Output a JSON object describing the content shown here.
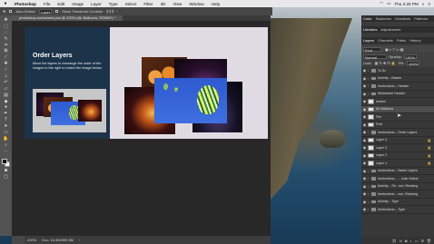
{
  "menubar": {
    "app_name": "Photoshop",
    "items": [
      "File",
      "Edit",
      "Image",
      "Layer",
      "Type",
      "Select",
      "Filter",
      "3D",
      "View",
      "Window",
      "Help"
    ],
    "clock": "Thu 2:20 PM"
  },
  "options_bar": {
    "auto_select_label": "Auto-Select:",
    "auto_select_value": "Layer",
    "transform_label": "Show Transform Controls"
  },
  "document": {
    "tab_title": "photoshop-worksheet.psd @ 200% (Air Balloons, RGB/8*) *",
    "zoom": "200%",
    "doc_size": "Doc: 24.9M/359.5M"
  },
  "canvas": {
    "title": "Order Layers",
    "instructions": "Move the layers to rearrange the order of the images to the right to match the image below."
  },
  "panels": {
    "top_tabs": [
      "Color",
      "Swatches",
      "Gradients",
      "Patterns"
    ],
    "mid_tabs": [
      "Libraries",
      "Adjustments"
    ],
    "layer_tabs": [
      "Layers",
      "Channels",
      "Paths",
      "History"
    ],
    "kind_label": "Kind",
    "blend_mode": "Normal",
    "opacity_label": "Opacity:",
    "opacity_value": "100%",
    "lock_label": "Lock:",
    "fill_label": "Fill:",
    "fill_value": "100%"
  },
  "layers": [
    {
      "name": "To Do",
      "type": "group",
      "visible": true,
      "selected": false,
      "locked": false
    },
    {
      "name": "Activity – Basics",
      "type": "group",
      "visible": true,
      "selected": false,
      "locked": false
    },
    {
      "name": "Instructions – Header",
      "type": "group",
      "visible": true,
      "selected": false,
      "locked": false
    },
    {
      "name": "Worksheet Header",
      "type": "group",
      "visible": true,
      "selected": false,
      "locked": false
    },
    {
      "name": "Instant",
      "type": "layer",
      "visible": true,
      "selected": false,
      "locked": false
    },
    {
      "name": "Air Balloons",
      "type": "layer",
      "visible": true,
      "selected": true,
      "locked": false
    },
    {
      "name": "Fire",
      "type": "layer",
      "visible": true,
      "selected": false,
      "locked": false
    },
    {
      "name": "Fruit",
      "type": "layer",
      "visible": true,
      "selected": false,
      "locked": false
    },
    {
      "name": "Instructions – Order Layers",
      "type": "group",
      "visible": true,
      "selected": false,
      "locked": false
    },
    {
      "name": "Layer 4",
      "type": "layer",
      "visible": true,
      "selected": false,
      "locked": true
    },
    {
      "name": "Layer 3",
      "type": "layer",
      "visible": true,
      "selected": false,
      "locked": true
    },
    {
      "name": "Layer 2",
      "type": "layer",
      "visible": true,
      "selected": false,
      "locked": true
    },
    {
      "name": "Layer 1",
      "type": "layer",
      "visible": true,
      "selected": false,
      "locked": true
    },
    {
      "name": "Instructions – Name Layers",
      "type": "group",
      "visible": true,
      "selected": false,
      "locked": false
    },
    {
      "name": "Instructions – ... Auto Select",
      "type": "group",
      "visible": true,
      "selected": false,
      "locked": false
    },
    {
      "name": "Activity – Sh...ove, Resizing",
      "type": "group",
      "visible": true,
      "selected": false,
      "locked": false
    },
    {
      "name": "Instructions ...ove, Resizing",
      "type": "group",
      "visible": true,
      "selected": false,
      "locked": false
    },
    {
      "name": "Activity – Type",
      "type": "group",
      "visible": true,
      "selected": false,
      "locked": false
    },
    {
      "name": "Instructions – Type",
      "type": "group",
      "visible": true,
      "selected": false,
      "locked": false
    }
  ]
}
